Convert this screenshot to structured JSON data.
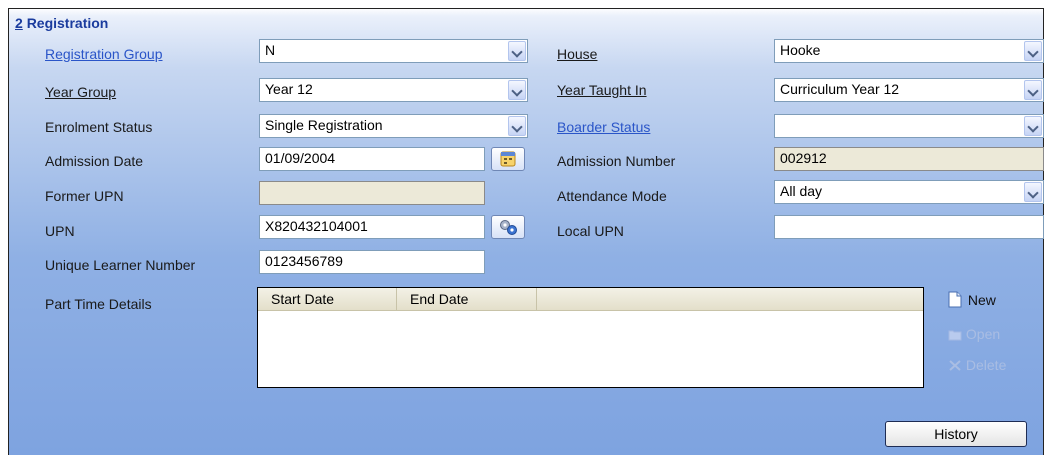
{
  "section": {
    "number": "2",
    "title": "Registration"
  },
  "left": {
    "registration_group": {
      "label": "Registration Group",
      "value": "N"
    },
    "year_group": {
      "label": "Year Group",
      "value": "Year 12"
    },
    "enrolment_status": {
      "label": "Enrolment Status",
      "value": "Single Registration"
    },
    "admission_date": {
      "label": "Admission Date",
      "value": "01/09/2004"
    },
    "former_upn": {
      "label": "Former UPN",
      "value": ""
    },
    "upn": {
      "label": "UPN",
      "value": "X820432104001"
    },
    "uln": {
      "label": "Unique Learner Number",
      "value": "0123456789"
    },
    "part_time": {
      "label": "Part Time Details"
    }
  },
  "right": {
    "house": {
      "label": "House",
      "value": "Hooke"
    },
    "year_taught_in": {
      "label": "Year Taught In",
      "value": "Curriculum Year 12"
    },
    "boarder_status": {
      "label": "Boarder Status",
      "value": ""
    },
    "admission_number": {
      "label": "Admission Number",
      "value": "002912"
    },
    "attendance_mode": {
      "label": "Attendance Mode",
      "value": "All day"
    },
    "local_upn": {
      "label": "Local UPN",
      "value": ""
    }
  },
  "grid": {
    "columns": [
      "Start Date",
      "End Date"
    ],
    "rows": []
  },
  "actions": {
    "new": "New",
    "open": "Open",
    "delete": "Delete",
    "history": "History"
  },
  "icons": {
    "calendar": "calendar-icon",
    "upn_generate": "gear-icon",
    "new": "new-document-icon",
    "open": "open-icon",
    "delete": "delete-icon"
  }
}
